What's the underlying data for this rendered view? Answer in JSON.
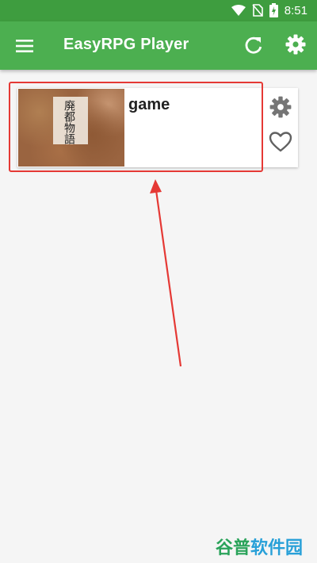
{
  "status_bar": {
    "time": "8:51"
  },
  "app_bar": {
    "title": "EasyRPG Player"
  },
  "game_list": [
    {
      "name": "game",
      "thumbnail_title": "廃都物語"
    }
  ],
  "watermark": {
    "part1": "谷普",
    "part2": "软件园"
  },
  "colors": {
    "primary": "#4caf50",
    "primary_dark": "#3e9d3f",
    "highlight": "#e53935"
  }
}
